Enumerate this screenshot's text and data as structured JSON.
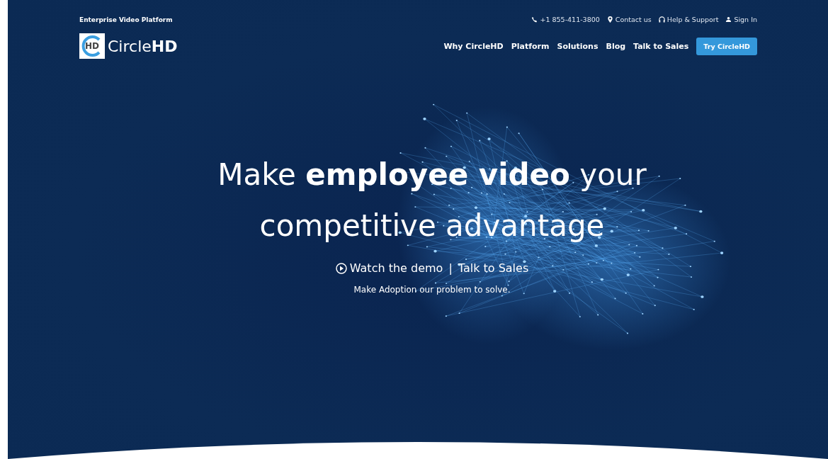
{
  "topbar": {
    "tagline": "Enterprise Video Platform",
    "links": [
      {
        "kind": "phone",
        "label": "+1 855-411-3800"
      },
      {
        "kind": "pin",
        "label": "Contact us"
      },
      {
        "kind": "headset",
        "label": "Help & Support"
      },
      {
        "kind": "user",
        "label": "Sign In"
      }
    ]
  },
  "logo": {
    "mark": "HD",
    "name_light": "Circle",
    "name_bold": "HD"
  },
  "nav": {
    "items": [
      "Why CircleHD",
      "Platform",
      "Solutions",
      "Blog",
      "Talk to Sales"
    ],
    "cta": "Try CircleHD"
  },
  "hero": {
    "headline": "Make **employee video** your competitive advantage",
    "demo_link": "Watch the demo",
    "separator": "|",
    "sales_link": "Talk to Sales",
    "tagline": "Make Adoption our problem to solve."
  }
}
